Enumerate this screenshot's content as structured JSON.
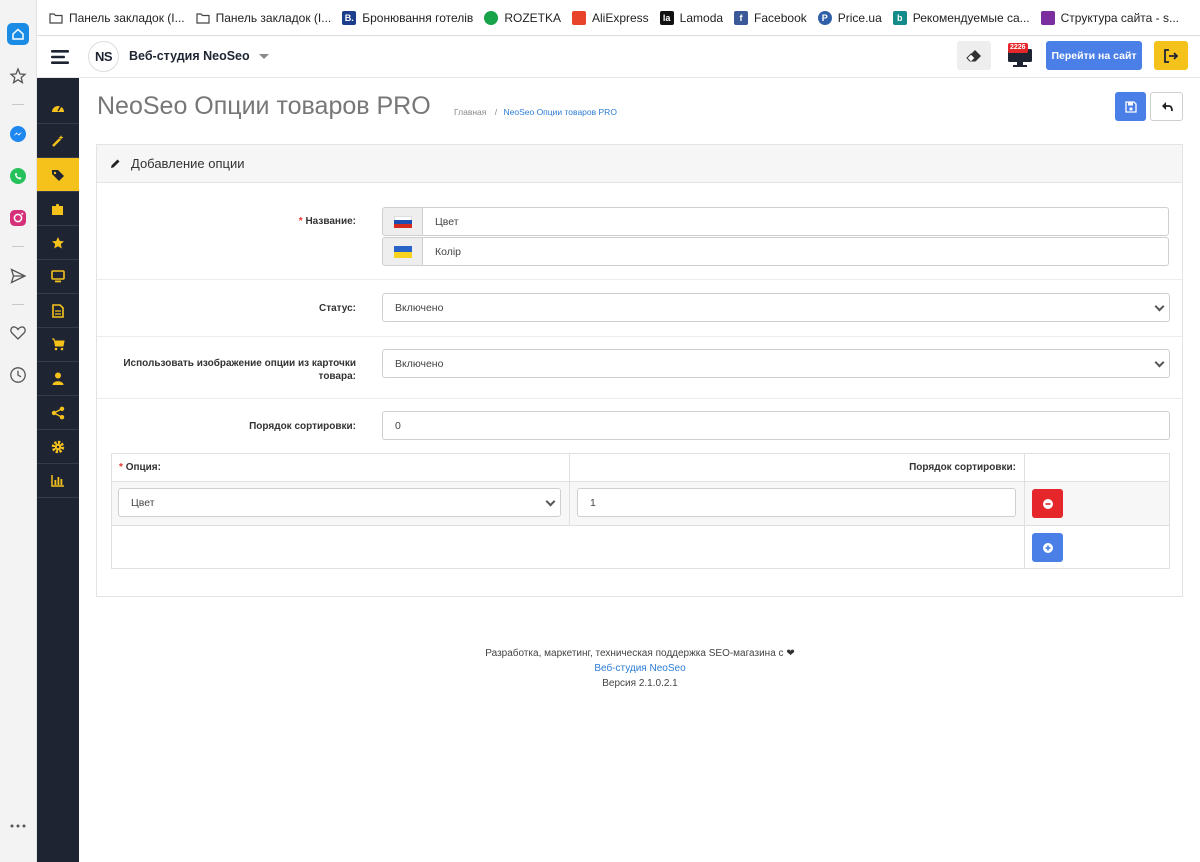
{
  "bookmarks": [
    {
      "label": "Панель закладок (I...",
      "icon": "folder-icon"
    },
    {
      "label": "Панель закладок (I...",
      "icon": "folder-icon"
    },
    {
      "label": "Бронювання готелів",
      "icon": "booking-icon",
      "glyph": "B.",
      "color": "#1d3e8a"
    },
    {
      "label": "ROZETKA",
      "icon": "rozetka-icon",
      "glyph": "",
      "color": "#16a34a"
    },
    {
      "label": "AliExpress",
      "icon": "aliexpress-icon",
      "glyph": "",
      "color": "#e8432b"
    },
    {
      "label": "Lamoda",
      "icon": "lamoda-icon",
      "glyph": "la",
      "color": "#111111"
    },
    {
      "label": "Facebook",
      "icon": "facebook-icon",
      "glyph": "f",
      "color": "#3b5998"
    },
    {
      "label": "Price.ua",
      "icon": "priceua-icon",
      "glyph": "P",
      "color": "#2f5fa8"
    },
    {
      "label": "Рекомендуемые са...",
      "icon": "bing-icon",
      "glyph": "b",
      "color": "#138b8b"
    },
    {
      "label": "Структура сайта - s...",
      "icon": "cart-icon",
      "glyph": "",
      "color": "#7b2f9e"
    }
  ],
  "topbar": {
    "logo_text": "NS",
    "studio_name": "Веб-студия NeoSeo",
    "notification_count": "2226",
    "go_to_site": "Перейти на сайт"
  },
  "page": {
    "title": "NeoSeo Опции товаров PRO",
    "breadcrumb_home": "Главная",
    "breadcrumb_separator": "/",
    "breadcrumb_current": "NeoSeo Опции товаров PRO"
  },
  "form": {
    "panel_title": "Добавление опции",
    "required_mark": "*",
    "name_label": "Название:",
    "name_ru": "Цвет",
    "name_ua": "Колір",
    "status_label": "Статус:",
    "status_value": "Включено",
    "use_image_label": "Использовать изображение опции из карточки товара:",
    "use_image_value": "Включено",
    "sort_label": "Порядок сортировки:",
    "sort_value": "0"
  },
  "option_table": {
    "col_option": "Опция:",
    "col_sort": "Порядок сортировки:",
    "rows": [
      {
        "option": "Цвет",
        "sort": "1"
      }
    ]
  },
  "footer": {
    "line1": "Разработка, маркетинг, техническая поддержка SEO-магазина с",
    "link": "Веб-студия NeoSeo",
    "version": "Версия 2.1.0.2.1"
  },
  "colors": {
    "sidebar_bg": "#1f2433",
    "accent_yellow": "#f5c21b",
    "primary_blue": "#4a7fe8",
    "danger_red": "#e5262b",
    "link_blue": "#2d7cd6"
  }
}
